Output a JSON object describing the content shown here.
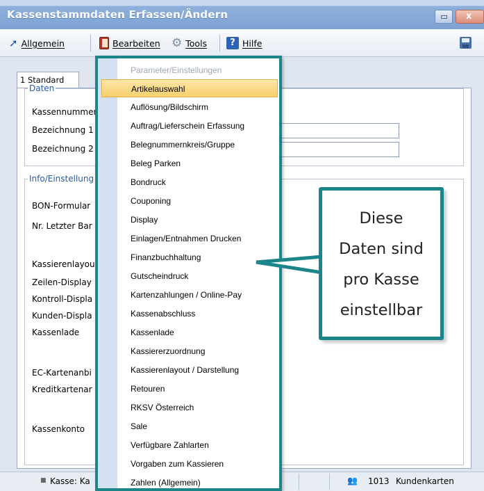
{
  "window": {
    "title": "Kassenstammdaten Erfassen/Ändern",
    "close_glyph": "x"
  },
  "toolbar": {
    "allgemein": "Allgemein",
    "bearbeiten": "Bearbeiten",
    "tools": "Tools",
    "hilfe": "Hilfe",
    "help_glyph": "?"
  },
  "tabs": [
    {
      "label": "1 Standard"
    }
  ],
  "groups": {
    "daten": "Daten",
    "info": "Info/Einstellung"
  },
  "fields": {
    "kassennummer": "Kassennummer",
    "bezeichnung1": "Bezeichnung 1",
    "bezeichnung2": "Bezeichnung 2",
    "bon_formular": "BON-Formular",
    "nr_letzter_bar": "Nr. Letzter Bar",
    "kassierenlayout": "Kassierenlayou",
    "zeilen_display": "Zeilen-Display",
    "kontroll_display": "Kontroll-Displa",
    "kunden_display": "Kunden-Displa",
    "kassenlade": "Kassenlade",
    "ec_kartenanbieter": "EC-Kartenanbi",
    "kreditkartenanbieter": "Kreditkartenar",
    "kassenkonto": "Kassenkonto"
  },
  "menu": {
    "items": [
      {
        "label": "Parameter/Einstellungen"
      },
      {
        "label": "Artikelauswahl"
      },
      {
        "label": "Auflösung/Bildschirm"
      },
      {
        "label": "Auftrag/Lieferschein Erfassung"
      },
      {
        "label": "Belegnummernkreis/Gruppe"
      },
      {
        "label": "Beleg Parken"
      },
      {
        "label": "Bondruck"
      },
      {
        "label": "Couponing"
      },
      {
        "label": "Display"
      },
      {
        "label": "Einlagen/Entnahmen Drucken"
      },
      {
        "label": "Finanzbuchhaltung"
      },
      {
        "label": "Gutscheindruck"
      },
      {
        "label": "Kartenzahlungen / Online-Pay"
      },
      {
        "label": "Kassenabschluss"
      },
      {
        "label": "Kassenlade"
      },
      {
        "label": "Kassiererzuordnung"
      },
      {
        "label": "Kassierenlayout / Darstellung"
      },
      {
        "label": "Retouren"
      },
      {
        "label": "RKSV Österreich"
      },
      {
        "label": "Sale"
      },
      {
        "label": "Verfügbare Zahlarten"
      },
      {
        "label": "Vorgaben zum Kassieren"
      },
      {
        "label": "Zahlen (Allgemein)"
      }
    ]
  },
  "callout": {
    "line1": "Diese",
    "line2": "Daten sind",
    "line3": "pro Kasse",
    "line4": "einstellbar"
  },
  "statusbar": {
    "bullet": "■",
    "kasse": "Kasse: Ka",
    "number": "1013",
    "kundenkarten": "Kundenkarten"
  },
  "colors": {
    "accent_teal": "#1b8589",
    "menu_highlight": "#f8cf6c",
    "titlebar": "#7fa2d3"
  },
  "icons": {
    "allgemein": "arrow-icon",
    "bearbeiten": "book-icon",
    "tools": "gear-icon",
    "hilfe": "help-icon",
    "save": "save-icon"
  }
}
